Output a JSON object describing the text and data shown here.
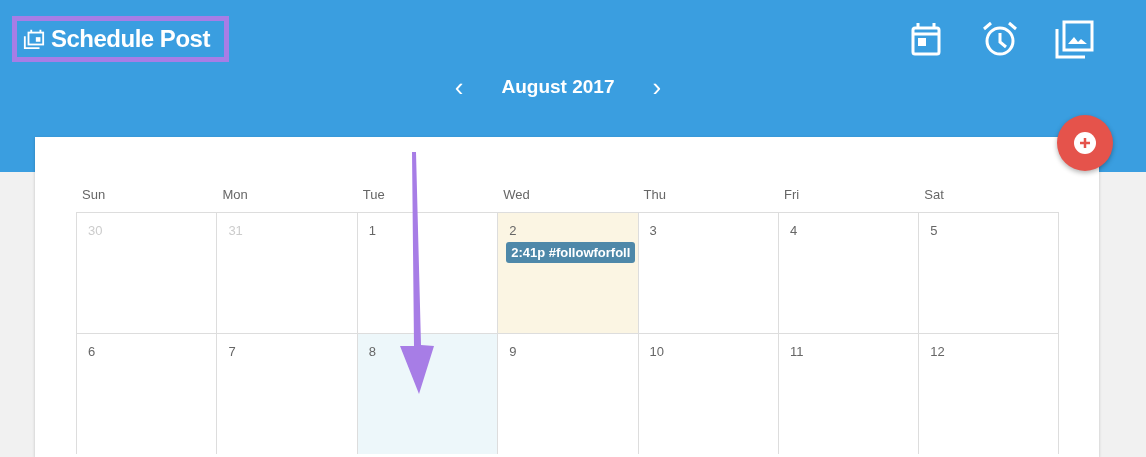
{
  "header": {
    "title": "Schedule Post"
  },
  "month_nav": {
    "prev": "‹",
    "label": "August 2017",
    "next": "›"
  },
  "weekdays": [
    "Sun",
    "Mon",
    "Tue",
    "Wed",
    "Thu",
    "Fri",
    "Sat"
  ],
  "weeks": [
    [
      {
        "day": "30",
        "kind": "other"
      },
      {
        "day": "31",
        "kind": "other"
      },
      {
        "day": "1",
        "kind": "current"
      },
      {
        "day": "2",
        "kind": "today",
        "events": [
          {
            "time": "2:41p",
            "text": "#followforfoll"
          }
        ]
      },
      {
        "day": "3",
        "kind": "current"
      },
      {
        "day": "4",
        "kind": "current"
      },
      {
        "day": "5",
        "kind": "current"
      }
    ],
    [
      {
        "day": "6",
        "kind": "current"
      },
      {
        "day": "7",
        "kind": "current"
      },
      {
        "day": "8",
        "kind": "selected"
      },
      {
        "day": "9",
        "kind": "current"
      },
      {
        "day": "10",
        "kind": "current"
      },
      {
        "day": "11",
        "kind": "current"
      },
      {
        "day": "12",
        "kind": "current"
      }
    ]
  ]
}
